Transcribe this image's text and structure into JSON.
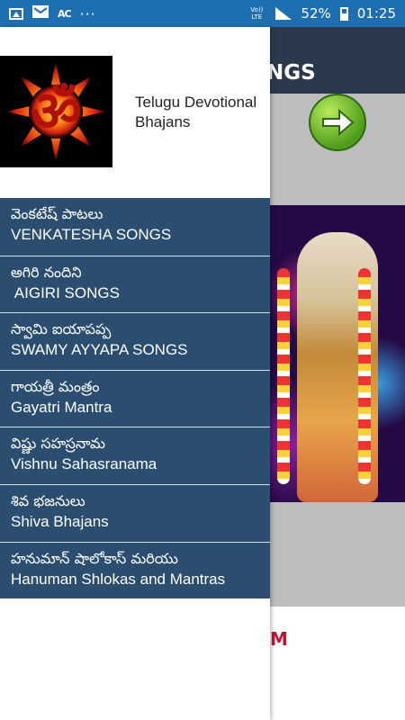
{
  "status_bar": {
    "icons_left": [
      "image-icon",
      "mail-icon",
      "ac-icon",
      "more-dots-icon"
    ],
    "ac_text": "AC",
    "dots_text": "···",
    "volte_text": "Vo)) LTE",
    "battery_percent": "52%",
    "time": "01:25",
    "color": "#1e6fb0"
  },
  "background_app": {
    "toolbar_title_fragment": "NGS",
    "bottom_text_fragment": "M",
    "toolbar_color": "#2a3a4c",
    "accent_red": "#c01530"
  },
  "drawer": {
    "header_title": "Telugu Devotional Bhajans",
    "logo_symbol": "ॐ",
    "item_color": "#2a4d70",
    "items": [
      {
        "telugu": "వెంకటేష్ పాటలు",
        "english": "VENKATESHA SONGS"
      },
      {
        "telugu": "అగిరి నందిని",
        "english": " AIGIRI SONGS"
      },
      {
        "telugu": "స్వామి ఐయాపప్ప",
        "english": "SWAMY AYYAPA SONGS"
      },
      {
        "telugu": "గాయత్రీ మంత్రం",
        "english": "Gayatri Mantra"
      },
      {
        "telugu": "విష్ణు సహస్రనామ",
        "english": "Vishnu Sahasranama"
      },
      {
        "telugu": "శివ భజనులు",
        "english": "Shiva Bhajans"
      },
      {
        "telugu": "హనుమాన్ షాలోకాస్ మరియు",
        "english": "Hanuman Shlokas and Mantras"
      }
    ]
  }
}
